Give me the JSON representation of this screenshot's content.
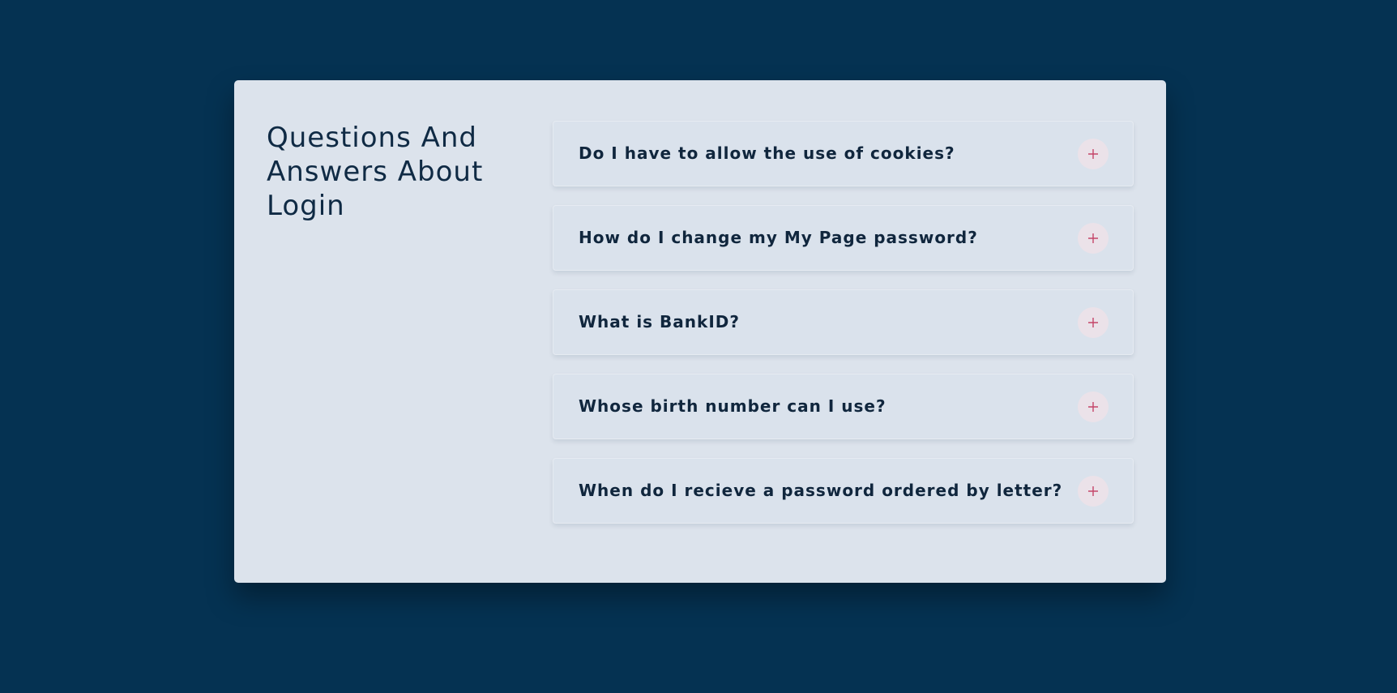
{
  "heading": "Questions And Answers About Login",
  "faq": [
    {
      "question": "Do I have to allow the use of cookies?",
      "expanded": false
    },
    {
      "question": "How do I change my My Page password?",
      "expanded": false
    },
    {
      "question": "What is BankID?",
      "expanded": false
    },
    {
      "question": "Whose birth number can I use?",
      "expanded": false
    },
    {
      "question": "When do I recieve a password ordered by letter?",
      "expanded": false
    }
  ],
  "colors": {
    "background": "#053252",
    "card": "#dce3ec",
    "text": "#10263d",
    "accent": "#c44569",
    "toggle_bg": "#ebe2e9"
  },
  "icons": {
    "toggle": "plus-icon"
  }
}
